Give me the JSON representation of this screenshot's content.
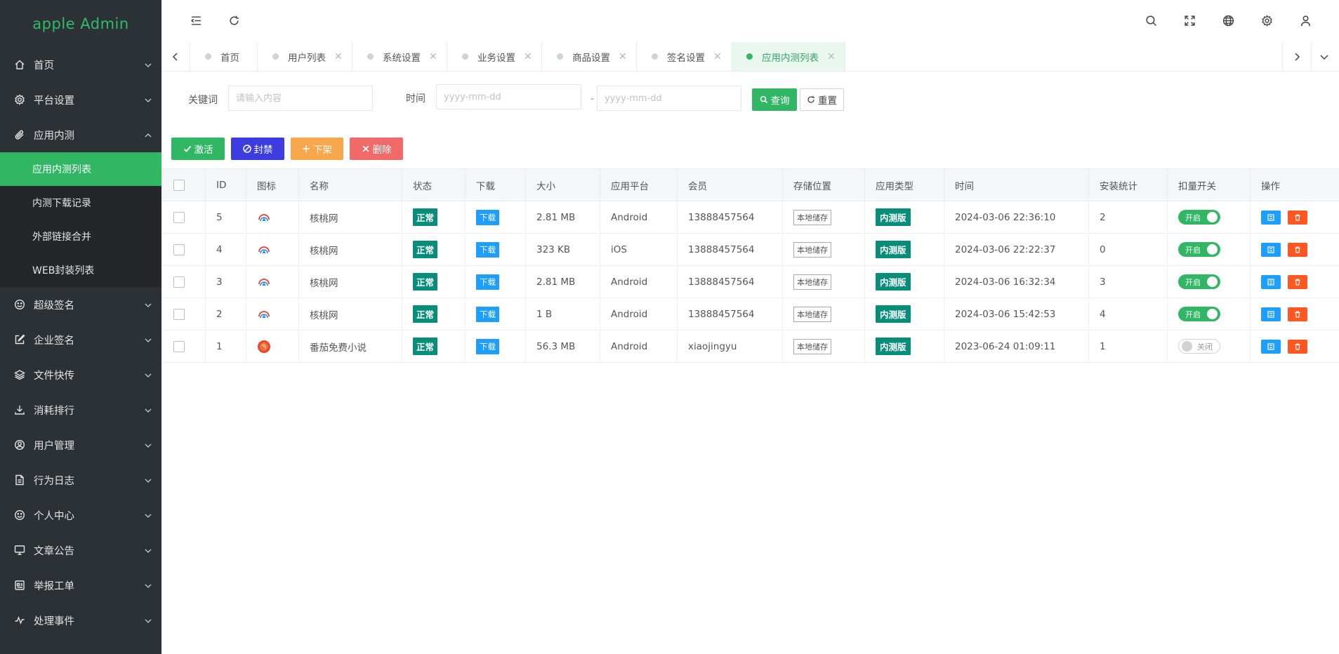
{
  "app": {
    "title": "apple Admin"
  },
  "sidebar": {
    "items": [
      {
        "label": "首页",
        "icon": "home-icon"
      },
      {
        "label": "平台设置",
        "icon": "gear-icon"
      },
      {
        "label": "应用内测",
        "icon": "paperclip-icon",
        "expanded": true,
        "children": [
          {
            "label": "应用内测列表",
            "active": true
          },
          {
            "label": "内测下载记录"
          },
          {
            "label": "外部链接合并"
          },
          {
            "label": "WEB封装列表"
          }
        ]
      },
      {
        "label": "超级签名",
        "icon": "smile-icon"
      },
      {
        "label": "企业签名",
        "icon": "edit-icon"
      },
      {
        "label": "文件快传",
        "icon": "layers-icon"
      },
      {
        "label": "消耗排行",
        "icon": "download-icon"
      },
      {
        "label": "用户管理",
        "icon": "user-circle-icon"
      },
      {
        "label": "行为日志",
        "icon": "log-file-icon"
      },
      {
        "label": "个人中心",
        "icon": "smile-icon"
      },
      {
        "label": "文章公告",
        "icon": "monitor-icon"
      },
      {
        "label": "举报工单",
        "icon": "report-icon"
      },
      {
        "label": "处理事件",
        "icon": "activity-icon"
      }
    ]
  },
  "header": {
    "icons": [
      "menu-fold-icon",
      "refresh-icon",
      "search-icon",
      "fullscreen-icon",
      "globe-icon",
      "gear-icon",
      "user-icon"
    ]
  },
  "tabs": [
    {
      "label": "首页",
      "closable": false
    },
    {
      "label": "用户列表",
      "closable": true
    },
    {
      "label": "系统设置",
      "closable": true
    },
    {
      "label": "业务设置",
      "closable": true
    },
    {
      "label": "商品设置",
      "closable": true
    },
    {
      "label": "签名设置",
      "closable": true
    },
    {
      "label": "应用内测列表",
      "closable": true,
      "active": true
    }
  ],
  "tab_close_glyph": "✕",
  "filter": {
    "keyword_label": "关键词",
    "keyword_placeholder": "请输入内容",
    "time_label": "时间",
    "date_placeholder": "yyyy-mm-dd",
    "date_sep": "-",
    "query_button": "查询",
    "reset_button": "重置"
  },
  "actions": {
    "activate": "激活",
    "ban": "封禁",
    "takedown": "下架",
    "delete": "删除"
  },
  "colors": {
    "accent_green": "#31b764",
    "ban_blue": "#3c3ce0",
    "takedown_orange": "#f8a74d",
    "delete_red": "#f06a6a",
    "teal": "#078e7a",
    "blue": "#1e9fff",
    "danger": "#ff5722"
  },
  "table": {
    "columns": [
      "ID",
      "图标",
      "名称",
      "状态",
      "下载",
      "大小",
      "应用平台",
      "会员",
      "存储位置",
      "应用类型",
      "时间",
      "安装统计",
      "扣量开关",
      "操作"
    ],
    "rows": [
      {
        "id": "5",
        "icon": "hetao-app-icon",
        "name": "核桃网",
        "status": "正常",
        "download": "下载",
        "size": "2.81 MB",
        "platform": "Android",
        "member": "13888457564",
        "storage": "本地储存",
        "type": "内测版",
        "time": "2024-03-06 22:36:10",
        "installs": "2",
        "switch": "开启",
        "switch_on": true
      },
      {
        "id": "4",
        "icon": "hetao-app-icon",
        "name": "核桃网",
        "status": "正常",
        "download": "下载",
        "size": "323 KB",
        "platform": "iOS",
        "member": "13888457564",
        "storage": "本地储存",
        "type": "内测版",
        "time": "2024-03-06 22:22:37",
        "installs": "0",
        "switch": "开启",
        "switch_on": true
      },
      {
        "id": "3",
        "icon": "hetao-app-icon",
        "name": "核桃网",
        "status": "正常",
        "download": "下载",
        "size": "2.81 MB",
        "platform": "Android",
        "member": "13888457564",
        "storage": "本地储存",
        "type": "内测版",
        "time": "2024-03-06 16:32:34",
        "installs": "3",
        "switch": "开启",
        "switch_on": true
      },
      {
        "id": "2",
        "icon": "hetao-app-icon",
        "name": "核桃网",
        "status": "正常",
        "download": "下载",
        "size": "1 B",
        "platform": "Android",
        "member": "13888457564",
        "storage": "本地储存",
        "type": "内测版",
        "time": "2024-03-06 15:42:53",
        "installs": "4",
        "switch": "开启",
        "switch_on": true
      },
      {
        "id": "1",
        "icon": "fanqie-app-icon",
        "name": "番茄免费小说",
        "status": "正常",
        "download": "下载",
        "size": "56.3 MB",
        "platform": "Android",
        "member": "xiaojingyu",
        "storage": "本地储存",
        "type": "内测版",
        "time": "2023-06-24 01:09:11",
        "installs": "1",
        "switch": "关闭",
        "switch_on": false
      }
    ]
  }
}
